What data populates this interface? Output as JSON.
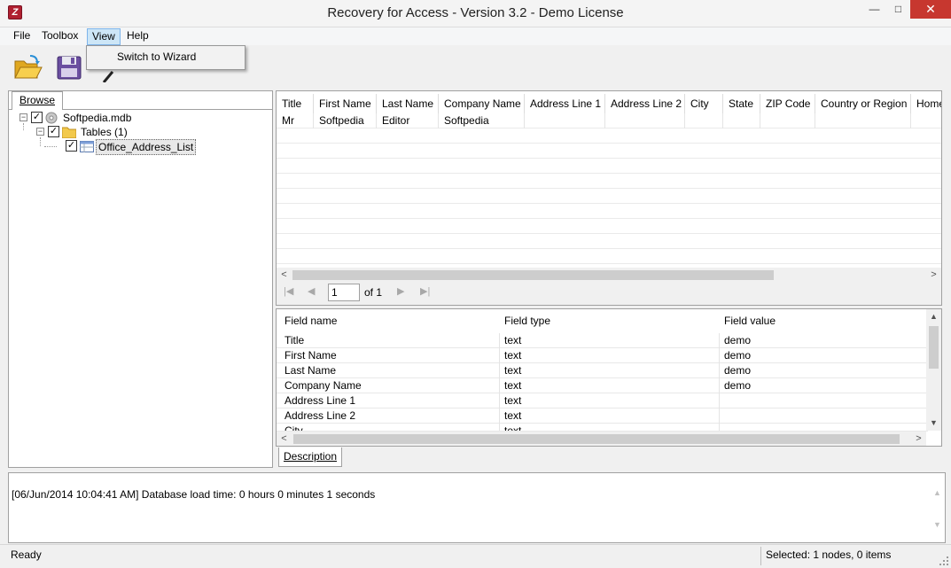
{
  "window": {
    "title": "Recovery for Access - Version 3.2 - Demo License",
    "minimize": "—",
    "maximize": "□",
    "close": "✕"
  },
  "menu": {
    "items": [
      "File",
      "Toolbox",
      "View",
      "Help"
    ],
    "open_menu": "View",
    "dropdown": [
      "Switch to Wizard"
    ]
  },
  "toolbar": {
    "buttons": [
      {
        "name": "open",
        "icon": "folder-open-icon"
      },
      {
        "name": "save",
        "icon": "floppy-disk-icon"
      },
      {
        "name": "wizard",
        "icon": "magic-wand-icon"
      }
    ]
  },
  "tree": {
    "tab_label": "Browse",
    "nodes": [
      {
        "label": "Softpedia.mdb",
        "checked": true,
        "level": 0,
        "icon": "database-icon"
      },
      {
        "label": "Tables (1)",
        "checked": true,
        "level": 1,
        "icon": "folder-icon"
      },
      {
        "label": "Office_Address_List",
        "checked": true,
        "level": 2,
        "icon": "table-icon",
        "selected": true
      }
    ]
  },
  "grid": {
    "columns": [
      "Title",
      "First Name",
      "Last Name",
      "Company Name",
      "Address Line 1",
      "Address Line 2",
      "City",
      "State",
      "ZIP Code",
      "Country or Region",
      "Home"
    ],
    "rows": [
      [
        "Mr",
        "Softpedia",
        "Editor",
        "Softpedia",
        "",
        "",
        "",
        "",
        "",
        "",
        ""
      ]
    ],
    "pager": {
      "page": "1",
      "of_label": "of 1"
    }
  },
  "fields": {
    "headers": [
      "Field name",
      "Field type",
      "Field value"
    ],
    "rows": [
      [
        "Title",
        "text",
        "demo"
      ],
      [
        "First Name",
        "text",
        "demo"
      ],
      [
        "Last Name",
        "text",
        "demo"
      ],
      [
        "Company Name",
        "text",
        "demo"
      ],
      [
        "Address Line 1",
        "text",
        ""
      ],
      [
        "Address Line 2",
        "text",
        ""
      ],
      [
        "City",
        "text",
        ""
      ]
    ],
    "tab_label": "Description"
  },
  "log": {
    "text": "[06/Jun/2014 10:04:41 AM] Database load time: 0 hours 0 minutes 1 seconds"
  },
  "status": {
    "left": "Ready",
    "right": "Selected: 1 nodes, 0 items"
  },
  "colors": {
    "close_button": "#c7372f",
    "menu_highlight": "#cde6f7",
    "folder": "#f2c94c",
    "save_disk": "#6b4fa0"
  }
}
